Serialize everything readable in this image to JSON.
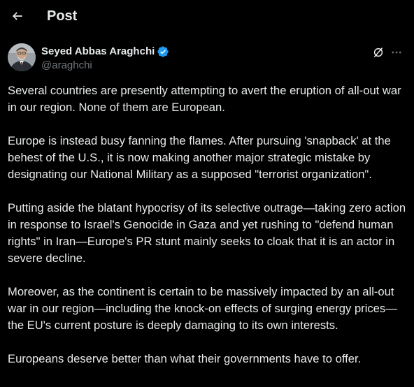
{
  "header": {
    "title": "Post"
  },
  "author": {
    "name": "Seyed Abbas Araghchi",
    "handle": "@araghchi"
  },
  "post": {
    "paragraphs": [
      "Several countries are presently attempting to avert the eruption of all-out war in our region. None of them are European.",
      "Europe is instead busy fanning the flames. After pursuing 'snapback' at the behest of the U.S., it is now making another major strategic mistake by designating our National Military as a supposed \"terrorist organization\".",
      "Putting aside the blatant hypocrisy of its selective outrage—taking zero action in response to Israel's Genocide in Gaza and yet rushing to \"defend human rights\" in Iran—Europe's PR stunt mainly seeks to cloak that it is an actor in severe decline.",
      "Moreover, as the continent is certain to be massively impacted by an all-out war in our region—including the knock-on effects of surging energy prices—the EU's current posture is deeply damaging to its own interests.",
      "Europeans deserve better than what their governments have to offer."
    ]
  },
  "icons": {
    "back": "back-arrow-icon",
    "verified": "verified-badge-icon",
    "grok": "grok-icon",
    "more": "more-icon"
  },
  "colors": {
    "background": "#000000",
    "text": "#e7e9ea",
    "secondary_text": "#71767b",
    "verified_blue": "#1d9bf0"
  }
}
